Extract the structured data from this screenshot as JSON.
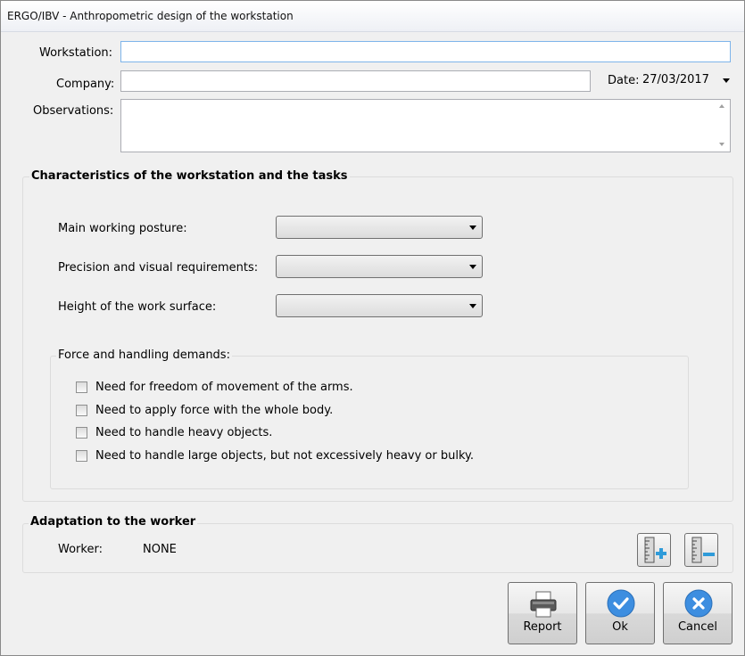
{
  "window": {
    "title": "ERGO/IBV - Anthropometric design of the workstation"
  },
  "header": {
    "workstation_label": "Workstation:",
    "workstation_value": "",
    "company_label": "Company:",
    "company_value": "",
    "date_label": "Date:",
    "date_value": "27/03/2017",
    "observations_label": "Observations:",
    "observations_value": ""
  },
  "characteristics": {
    "title": "Characteristics of the workstation and the tasks",
    "posture_label": "Main working posture:",
    "posture_value": "",
    "precision_label": "Precision and visual requirements:",
    "precision_value": "",
    "height_label": "Height of the work surface:",
    "height_value": "",
    "force": {
      "title": "Force and handling demands:",
      "options": [
        {
          "label": "Need for freedom of movement of the arms.",
          "checked": false
        },
        {
          "label": "Need to apply force with the whole body.",
          "checked": false
        },
        {
          "label": "Need to handle heavy objects.",
          "checked": false
        },
        {
          "label": "Need to handle large objects, but not excessively heavy or bulky.",
          "checked": false
        }
      ]
    }
  },
  "adaptation": {
    "title": "Adaptation to the worker",
    "worker_label": "Worker:",
    "worker_value": "NONE",
    "icons": [
      "ruler-add-icon",
      "ruler-remove-icon"
    ]
  },
  "actions": {
    "report_label": "Report",
    "ok_label": "Ok",
    "cancel_label": "Cancel"
  },
  "colors": {
    "accent_blue": "#3d8ee0",
    "focus_border": "#7eb4ea",
    "plus_green": "#2f9bd9"
  }
}
